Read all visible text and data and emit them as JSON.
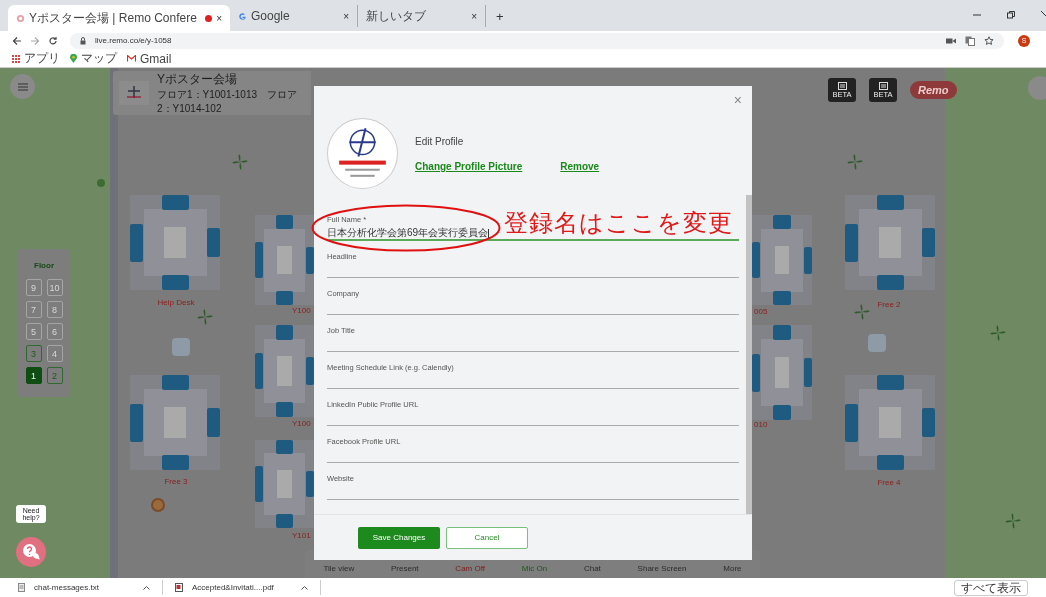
{
  "browser": {
    "tabs": [
      {
        "title": "Yポスター会場 | Remo Confere",
        "selected": true,
        "recording": true,
        "close": "×"
      },
      {
        "title": "Google",
        "selected": false,
        "recording": false,
        "close": "×"
      },
      {
        "title": "新しいタブ",
        "selected": false,
        "recording": false,
        "close": "×"
      }
    ],
    "new_tab": "+",
    "url": "live.remo.co/e/y-1058",
    "profile_initial": "S",
    "bookmarks": [
      "アプリ",
      "マップ",
      "Gmail"
    ]
  },
  "venue": {
    "title": "Yポスター会場",
    "subtitle": "フロア1：Y1001-1013　フロア2：Y1014-102"
  },
  "top_badges": [
    "BETA",
    "BETA"
  ],
  "remo_logo": "Remo",
  "floor_panel": {
    "title": "Floor",
    "floors": [
      {
        "label": "9",
        "selected": false,
        "available": false
      },
      {
        "label": "10",
        "selected": false,
        "available": false
      },
      {
        "label": "7",
        "selected": false,
        "available": false
      },
      {
        "label": "8",
        "selected": false,
        "available": false
      },
      {
        "label": "5",
        "selected": false,
        "available": false
      },
      {
        "label": "6",
        "selected": false,
        "available": false
      },
      {
        "label": "3",
        "selected": false,
        "available": true
      },
      {
        "label": "4",
        "selected": false,
        "available": false
      },
      {
        "label": "1",
        "selected": true,
        "available": true
      },
      {
        "label": "2",
        "selected": false,
        "available": true
      }
    ]
  },
  "rooms": [
    {
      "label": "Help Desk"
    },
    {
      "label": "Y100"
    },
    {
      "label": "Y100"
    },
    {
      "label": "Y101"
    },
    {
      "label": "Free 3"
    },
    {
      "label": "005"
    },
    {
      "label": "010"
    },
    {
      "label": "Free 2"
    },
    {
      "label": "Free 4"
    }
  ],
  "help": {
    "bubble": "Need help?"
  },
  "toolbar": [
    {
      "label": "Tile view",
      "kind": "plain"
    },
    {
      "label": "Present",
      "kind": "plain"
    },
    {
      "label": "Cam Off",
      "kind": "off"
    },
    {
      "label": "Mic On",
      "kind": "on"
    },
    {
      "label": "Chat",
      "kind": "plain"
    },
    {
      "label": "Share Screen",
      "kind": "plain"
    },
    {
      "label": "More",
      "kind": "plain"
    }
  ],
  "modal": {
    "close": "×",
    "title": "Edit Profile",
    "change_picture": "Change Profile Picture",
    "remove": "Remove",
    "fields": [
      {
        "label": "Full Name *",
        "value": "日本分析化学会第69年会実行委員会",
        "focused": true
      },
      {
        "label": "Headline",
        "focused": false
      },
      {
        "label": "Company",
        "focused": false
      },
      {
        "label": "Job Title",
        "focused": false
      },
      {
        "label": "Meeting Schedule Link (e.g. Calendly)",
        "focused": false
      },
      {
        "label": "LinkedIn Public Profile URL",
        "focused": false
      },
      {
        "label": "Facebook Profile URL",
        "focused": false
      },
      {
        "label": "Website",
        "focused": false
      }
    ],
    "save": "Save Changes",
    "cancel": "Cancel"
  },
  "annotation": {
    "text": "登録名はここを変更"
  },
  "downloads": {
    "files": [
      {
        "name": "chat-messages.txt",
        "kind": "text"
      },
      {
        "name": "Accepted&Invitati....pdf",
        "kind": "pdf"
      }
    ],
    "show_all": "すべて表示"
  }
}
